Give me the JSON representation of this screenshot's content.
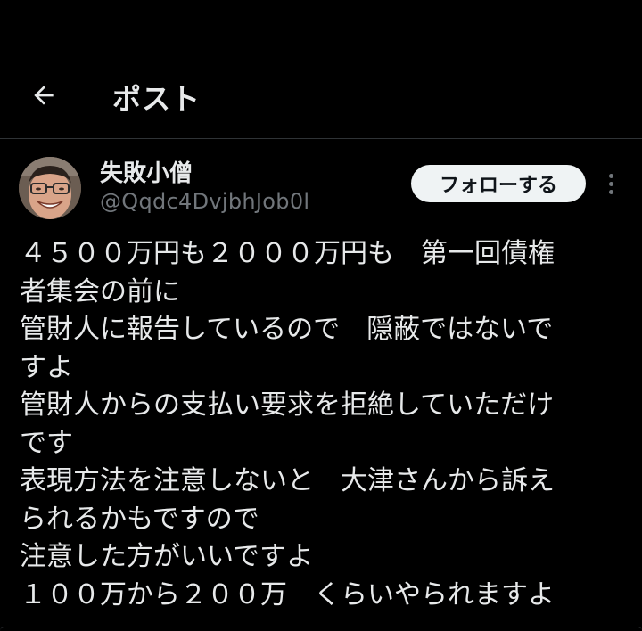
{
  "header": {
    "back_icon": "arrow-left-icon",
    "title": "ポスト"
  },
  "author": {
    "display_name": "失敗小僧",
    "handle": "@Qqdc4DvjbhJob0l",
    "avatar_icon": "avatar-photo",
    "follow_label": "フォローする",
    "more_icon": "more-vertical-icon"
  },
  "post": {
    "lines": [
      "４５００万円も２０００万円も　第一回債権",
      "者集会の前に",
      "管財人に報告しているので　隠蔽ではないで",
      "すよ",
      "管財人からの支払い要求を拒絶していただけ",
      "です",
      "表現方法を注意しないと　大津さんから訴え",
      "られるかもですので",
      "注意した方がいいですよ",
      "１００万から２００万　くらいやられますよ"
    ]
  },
  "colors": {
    "background": "#000000",
    "text": "#e7e9ea",
    "secondary": "#71767b",
    "divider": "#2f3336",
    "button_bg": "#eff3f4"
  }
}
